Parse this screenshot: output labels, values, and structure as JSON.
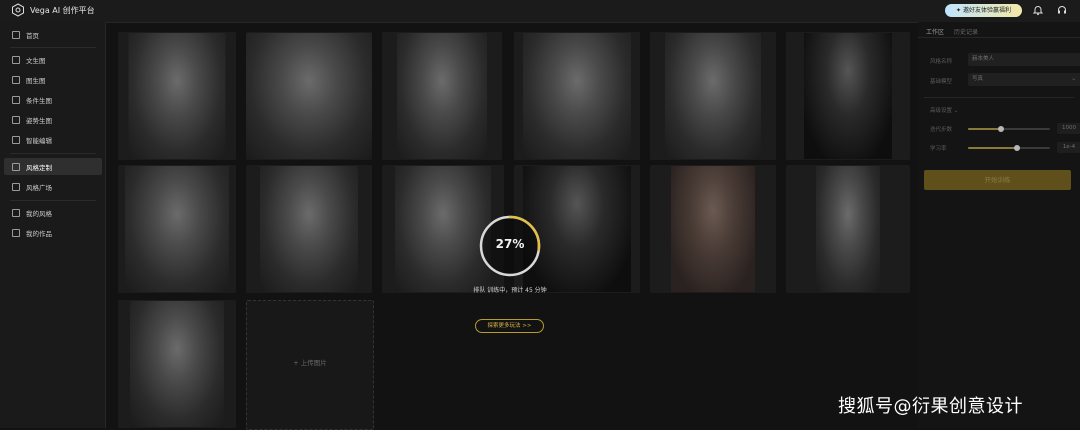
{
  "app": {
    "title": "Vega AI 创作平台"
  },
  "header": {
    "invite_label": "邀好友体验赢福利"
  },
  "icons": {
    "logo": "hexagon-logo-icon",
    "invite": "gift-icon",
    "notification": "bell-icon",
    "support": "headset-icon"
  },
  "sidebar": {
    "items": [
      {
        "label": "首页",
        "icon": "home-icon"
      },
      {
        "label": "文生图",
        "icon": "text-image-icon"
      },
      {
        "label": "图生图",
        "icon": "image-icon"
      },
      {
        "label": "条件生图",
        "icon": "sliders-icon"
      },
      {
        "label": "姿势生图",
        "icon": "pose-icon"
      },
      {
        "label": "智能编辑",
        "icon": "magic-edit-icon"
      },
      {
        "label": "风格定制",
        "icon": "style-custom-icon",
        "active": true
      },
      {
        "label": "风格广场",
        "icon": "style-square-icon"
      },
      {
        "label": "我的风格",
        "icon": "cube-icon"
      },
      {
        "label": "我的作品",
        "icon": "gallery-icon"
      }
    ]
  },
  "gallery": {
    "upload_label": "+ 上传图片"
  },
  "training": {
    "progress_percent": 27,
    "progress_text": "27%",
    "status_text": "排队 训练中，预计 45 分钟",
    "explore_label": "探索更多玩法 >>"
  },
  "panel": {
    "tabs": [
      "工作区",
      "历史记录"
    ],
    "fields": [
      {
        "label": "风格名称",
        "value": "赫本美人"
      },
      {
        "label": "基础模型",
        "value": "写真"
      }
    ],
    "advanced_label": "高级设置",
    "sliders": [
      {
        "label": "迭代步数",
        "value_text": "1000",
        "fraction": 0.4
      },
      {
        "label": "学习率",
        "value_text": "1e-4",
        "fraction": 0.6
      }
    ],
    "train_button_label": "开始训练"
  },
  "watermark": "搜狐号@衍果创意设计",
  "colors": {
    "accent": "#d9b94a",
    "background": "#121212",
    "sidebar": "#1a1a1a"
  }
}
